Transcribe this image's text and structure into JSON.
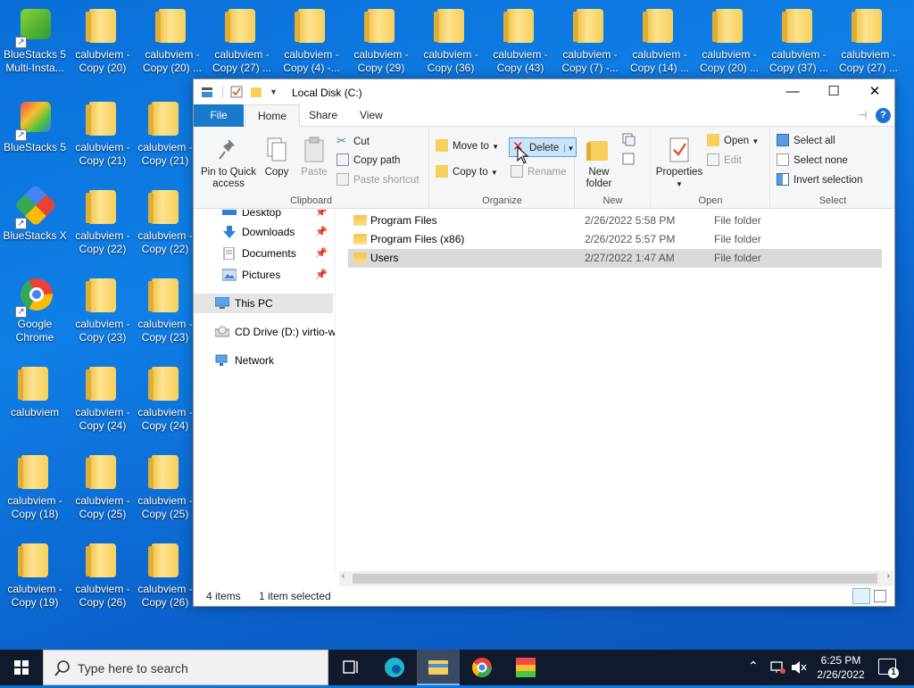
{
  "desktop": {
    "icons": [
      {
        "label": "BlueStacks 5 Multi-Insta..."
      },
      {
        "label": "calubviem - Copy (20)"
      },
      {
        "label": "calubviem - Copy (20) ..."
      },
      {
        "label": "calubviem - Copy (27) ..."
      },
      {
        "label": "calubviem - Copy (4) -..."
      },
      {
        "label": "calubviem - Copy (29)"
      },
      {
        "label": "calubviem - Copy (36)"
      },
      {
        "label": "calubviem - Copy (43)"
      },
      {
        "label": "calubviem - Copy (7) -..."
      },
      {
        "label": "calubviem - Copy (14) ..."
      },
      {
        "label": "calubviem - Copy (20) ..."
      },
      {
        "label": "calubviem - Copy (37) ..."
      },
      {
        "label": "calubviem - Copy (27) ..."
      },
      {
        "label": "BlueStacks 5"
      },
      {
        "label": "calubviem - Copy (21)"
      },
      {
        "label": "calubviem - Copy (21)"
      },
      {
        "label": "BlueStacks X"
      },
      {
        "label": "calubviem - Copy (22)"
      },
      {
        "label": "calubviem - Copy (22)"
      },
      {
        "label": "Google Chrome"
      },
      {
        "label": "calubviem - Copy (23)"
      },
      {
        "label": "calubviem - Copy (23)"
      },
      {
        "label": "calubviem"
      },
      {
        "label": "calubviem - Copy (24)"
      },
      {
        "label": "calubviem - Copy (24)"
      },
      {
        "label": "calubviem - Copy (18)"
      },
      {
        "label": "calubviem - Copy (25)"
      },
      {
        "label": "calubviem - Copy (25)"
      },
      {
        "label": "calubviem - Copy (19)"
      },
      {
        "label": "calubviem - Copy (26)"
      },
      {
        "label": "calubviem - Copy (26)"
      }
    ]
  },
  "explorer": {
    "title": "Local Disk (C:)",
    "tabs": {
      "file": "File",
      "home": "Home",
      "share": "Share",
      "view": "View"
    },
    "ribbon": {
      "clipboard": {
        "label": "Clipboard",
        "pin": "Pin to Quick access",
        "copy": "Copy",
        "paste": "Paste",
        "cut": "Cut",
        "copy_path": "Copy path",
        "paste_shortcut": "Paste shortcut"
      },
      "organize": {
        "label": "Organize",
        "move_to": "Move to",
        "copy_to": "Copy to",
        "delete": "Delete",
        "rename": "Rename"
      },
      "new": {
        "label": "New",
        "new_folder": "New folder"
      },
      "open": {
        "label": "Open",
        "properties": "Properties",
        "open": "Open",
        "edit": "Edit"
      },
      "select": {
        "label": "Select",
        "select_all": "Select all",
        "select_none": "Select none",
        "invert": "Invert selection"
      }
    },
    "nav": {
      "desktop": "Desktop",
      "downloads": "Downloads",
      "documents": "Documents",
      "pictures": "Pictures",
      "this_pc": "This PC",
      "cd_drive": "CD Drive (D:) virtio-w",
      "network": "Network"
    },
    "files": [
      {
        "name": "Program Files",
        "date": "2/26/2022 5:58 PM",
        "type": "File folder"
      },
      {
        "name": "Program Files (x86)",
        "date": "2/26/2022 5:57 PM",
        "type": "File folder"
      },
      {
        "name": "Users",
        "date": "2/27/2022 1:47 AM",
        "type": "File folder"
      }
    ],
    "status": {
      "items": "4 items",
      "selected": "1 item selected"
    }
  },
  "taskbar": {
    "search_placeholder": "Type here to search",
    "time": "6:25 PM",
    "date": "2/26/2022",
    "notifications": "1"
  }
}
